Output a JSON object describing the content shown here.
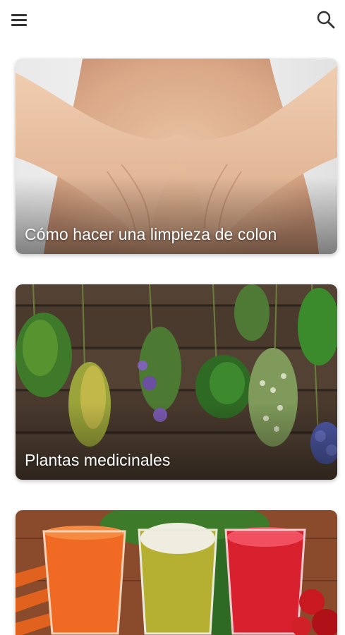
{
  "appbar": {
    "menu_icon": "hamburger-menu-icon",
    "search_icon": "search-icon"
  },
  "articles": [
    {
      "title": "Cómo hacer una limpieza de colon",
      "image": "hands-heart-on-belly"
    },
    {
      "title": "Plantas medicinales",
      "image": "hanging-herbs-on-wood"
    },
    {
      "title": "",
      "image": "vegetable-juices"
    }
  ],
  "colors": {
    "text_on_image": "#ffffff",
    "icon": "#333333",
    "background": "#ffffff"
  }
}
